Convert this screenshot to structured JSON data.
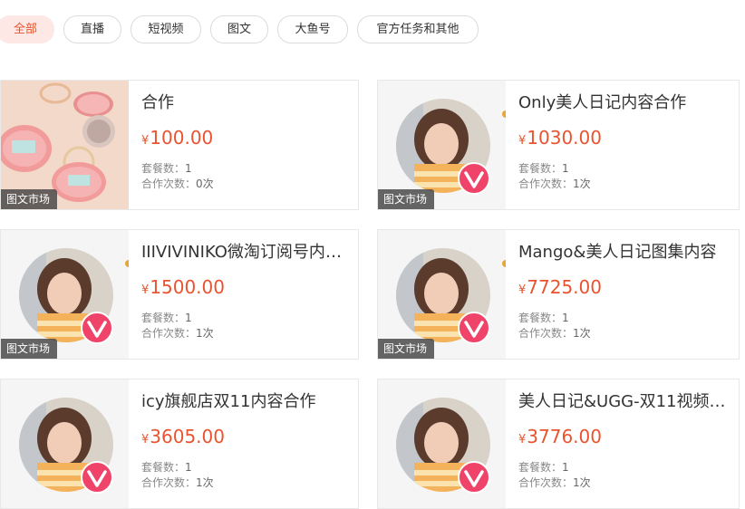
{
  "filters": [
    {
      "label": "全部",
      "active": true
    },
    {
      "label": "直播",
      "active": false
    },
    {
      "label": "短视频",
      "active": false
    },
    {
      "label": "图文",
      "active": false
    },
    {
      "label": "大鱼号",
      "active": false
    },
    {
      "label": "官方任务和其他",
      "active": false
    }
  ],
  "labels": {
    "currency": "¥",
    "package_count": "套餐数：",
    "collab_count": "合作次数："
  },
  "cards": [
    {
      "tag": "图文市场",
      "title": "合作",
      "price": "100.00",
      "packages": "1",
      "collabs": "0次",
      "thumb": "cosmetics"
    },
    {
      "tag": "图文市场",
      "title": "Only美人日记内容合作",
      "price": "1030.00",
      "packages": "1",
      "collabs": "1次",
      "thumb": "avatar"
    },
    {
      "tag": "图文市场",
      "title": "IIIVIVINIKO微淘订阅号内容...",
      "price": "1500.00",
      "packages": "1",
      "collabs": "1次",
      "thumb": "avatar"
    },
    {
      "tag": "图文市场",
      "title": "Mango&美人日记图集内容",
      "price": "7725.00",
      "packages": "1",
      "collabs": "1次",
      "thumb": "avatar"
    },
    {
      "tag": "",
      "title": "icy旗舰店双11内容合作",
      "price": "3605.00",
      "packages": "1",
      "collabs": "1次",
      "thumb": "avatar"
    },
    {
      "tag": "",
      "title": "美人日记&UGG-双11视频内...",
      "price": "3776.00",
      "packages": "1",
      "collabs": "1次",
      "thumb": "avatar"
    }
  ],
  "colors": {
    "accent": "#e8542f",
    "active_bg": "#fde8e6",
    "badge": "#f0436a"
  }
}
